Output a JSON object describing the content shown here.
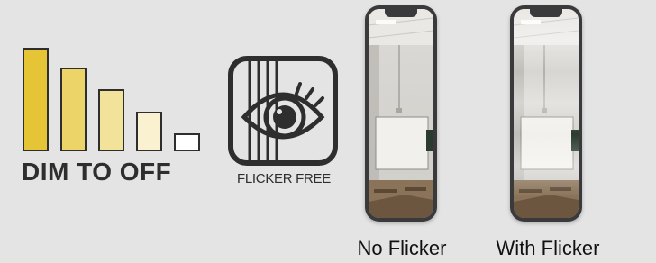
{
  "dim_to_off": {
    "label": "DIM TO OFF",
    "bar_colors": [
      "#e5c436",
      "#ecd468",
      "#f2e29a",
      "#f9f1cf",
      "#ffffff"
    ]
  },
  "flicker_free": {
    "label": "FLICKER FREE",
    "icon": "eye-with-lines-icon"
  },
  "phones": [
    {
      "label": "No Flicker"
    },
    {
      "label": "With Flicker"
    }
  ],
  "colors": {
    "background": "#e4e4e4",
    "outline": "#2e2e2e"
  }
}
